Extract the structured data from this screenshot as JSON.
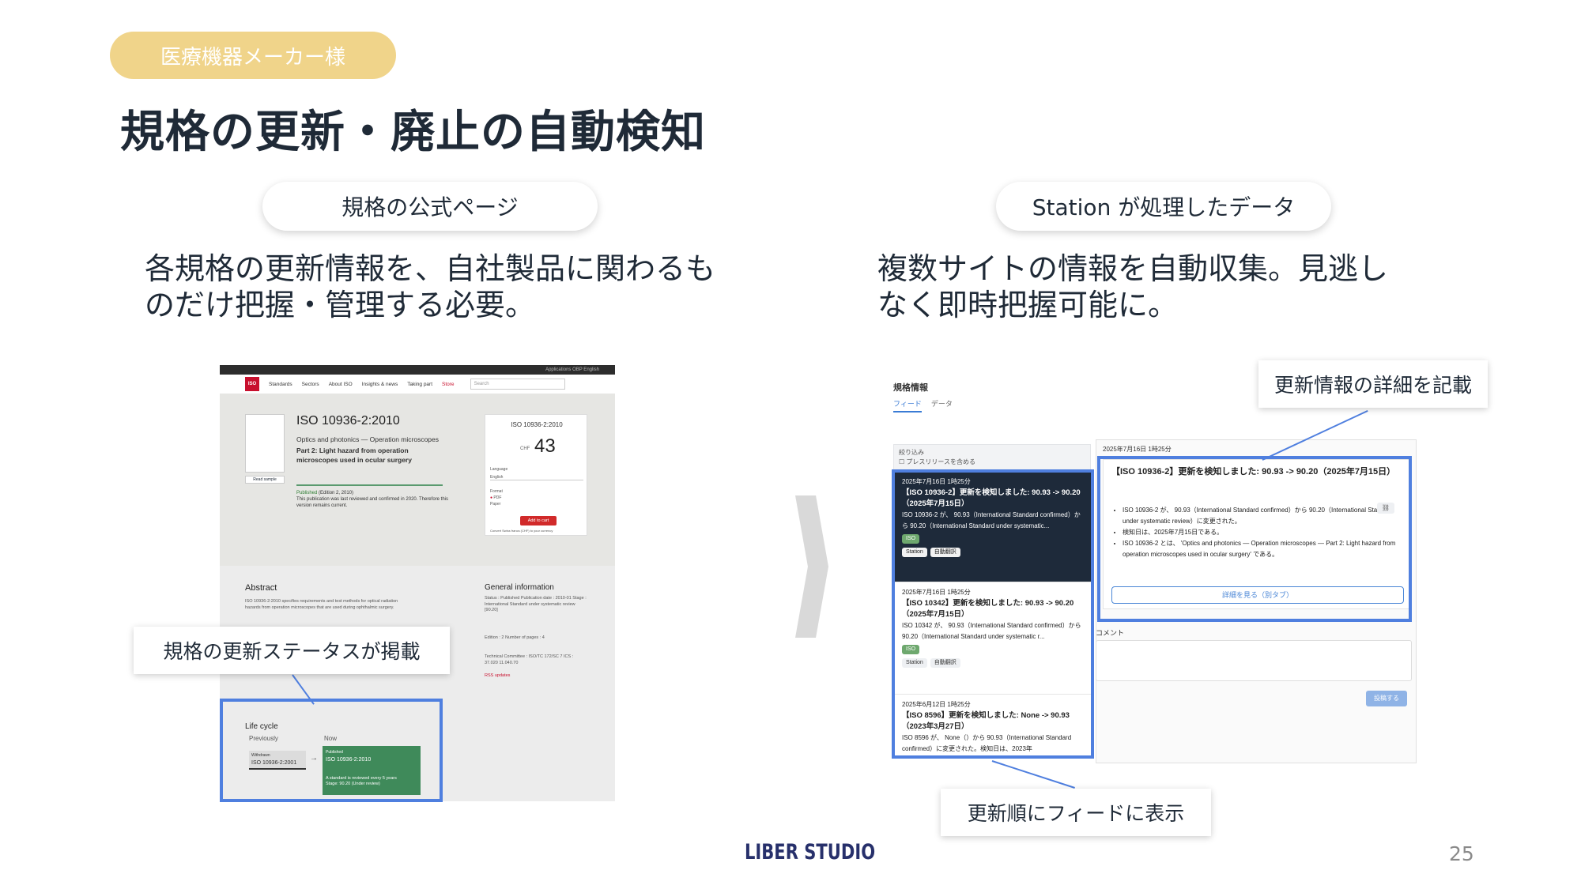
{
  "header": {
    "tag": "医療機器メーカー様",
    "title": "規格の更新・廃止の自動検知"
  },
  "left": {
    "pill": "規格の公式ページ",
    "description_line1": "各規格の更新情報を、自社製品に関わるも",
    "description_line2": "のだけ把握・管理する必要。",
    "callout": "規格の更新ステータスが掲載"
  },
  "right": {
    "pill": "Station が処理したデータ",
    "description_line1": "複数サイトの情報を自動収集。見逃し",
    "description_line2": "なく即時把握可能に。",
    "callout_detail": "更新情報の詳細を記載",
    "callout_feed": "更新順にフィードに表示"
  },
  "iso_page": {
    "topbar": "Applications   OBP   English",
    "logo": "ISO",
    "nav": [
      "Standards",
      "Sectors",
      "About ISO",
      "Insights & news",
      "Taking part",
      "Store"
    ],
    "search_placeholder": "Search",
    "read_sample": "Read sample",
    "standard_id": "ISO 10936-2:2010",
    "subtitle": "Optics and photonics — Operation microscopes",
    "part": "Part 2: Light hazard from operation microscopes used in ocular surgery",
    "status_published": "Published",
    "status_edition": "(Edition 2, 2010)",
    "status_text": "This publication was last reviewed and confirmed in 2020. Therefore this version remains current.",
    "buy_title": "ISO 10936-2:2010",
    "currency": "CHF",
    "price": "43",
    "language_label": "Language",
    "language_value": "English",
    "format_label": "Format",
    "format_pdf": "PDF",
    "format_paper": "Paper",
    "add_to_cart": "Add to cart",
    "convert_note": "Convert Swiss francs (CHF) to your currency",
    "abstract_title": "Abstract",
    "abstract_text": "ISO 10936-2:2010 specifies requirements and test methods for optical radiation hazards from operation microscopes that are used during ophthalmic surgery.",
    "general_title": "General information",
    "general_text": "Status : Published  Publication date : 2010-01  Stage : International Standard under systematic review [90.20]",
    "edition_text": "Edition : 2   Number of pages : 4",
    "tc_text": "Technical Committee : ISO/TC 172/SC 7   ICS : 37.020  11.040.70",
    "rss_text": "RSS updates",
    "lifecycle_title": "Life cycle",
    "previously": "Previously",
    "now": "Now",
    "prev_state": "Withdrawn",
    "prev_id": "ISO 10936-2:2001",
    "now_state": "Published",
    "now_id": "ISO 10936-2:2010",
    "now_note": "A standard is reviewed every 5 years",
    "now_stage": "Stage: 90.20 (Under review)"
  },
  "station": {
    "title": "規格情報",
    "tabs": [
      "フィード",
      "データ"
    ],
    "filter_label": "絞り込み",
    "filter_checkbox": "プレスリリースを含める",
    "feed": [
      {
        "date": "2025年7月16日 1時25分",
        "headline": "【ISO 10936-2】更新を検知しました: 90.93 -> 90.20（2025年7月15日）",
        "body": "ISO 10936-2 が、 90.93（International Standard confirmed）から 90.20（International Standard under systematic...",
        "badge": "ISO",
        "tags": [
          "Station",
          "自動翻訳"
        ]
      },
      {
        "date": "2025年7月16日 1時25分",
        "headline": "【ISO 10342】更新を検知しました: 90.93 -> 90.20（2025年7月15日）",
        "body": "ISO 10342 が、 90.93（International Standard confirmed）から 90.20（International Standard under systematic r...",
        "badge": "ISO",
        "tags": [
          "Station",
          "自動翻訳"
        ]
      },
      {
        "date": "2025年6月12日 1時25分",
        "headline": "【ISO 8596】更新を検知しました: None -> 90.93（2023年3月27日）",
        "body": "ISO 8596 が、 None（）から 90.93（International Standard confirmed）に変更された。検知日は、2023年",
        "badge": "",
        "tags": []
      }
    ],
    "detail_date": "2025年7月16日 1時25分",
    "detail_headline": "【ISO 10936-2】更新を検知しました: 90.93 -> 90.20（2025年7月15日）",
    "detail_bullets": [
      "ISO 10936-2 が、 90.93（International Standard confirmed）から 90.20（International Standard under systematic review）に変更された。",
      "検知日は、2025年7月15日である。",
      "ISO 10936-2 とは、 'Optics and photonics — Operation microscopes — Part 2: Light hazard from operation microscopes used in ocular surgery' である。"
    ],
    "detail_button": "詳細を見る（別タブ）",
    "comment_label": "コメント",
    "post_button": "投稿する"
  },
  "footer": {
    "logo": "LIBER STUDIO",
    "page_number": "25"
  },
  "colors": {
    "tag_bg": "#f0d48a",
    "highlight": "#4f7fdf",
    "logo": "#27306b"
  }
}
